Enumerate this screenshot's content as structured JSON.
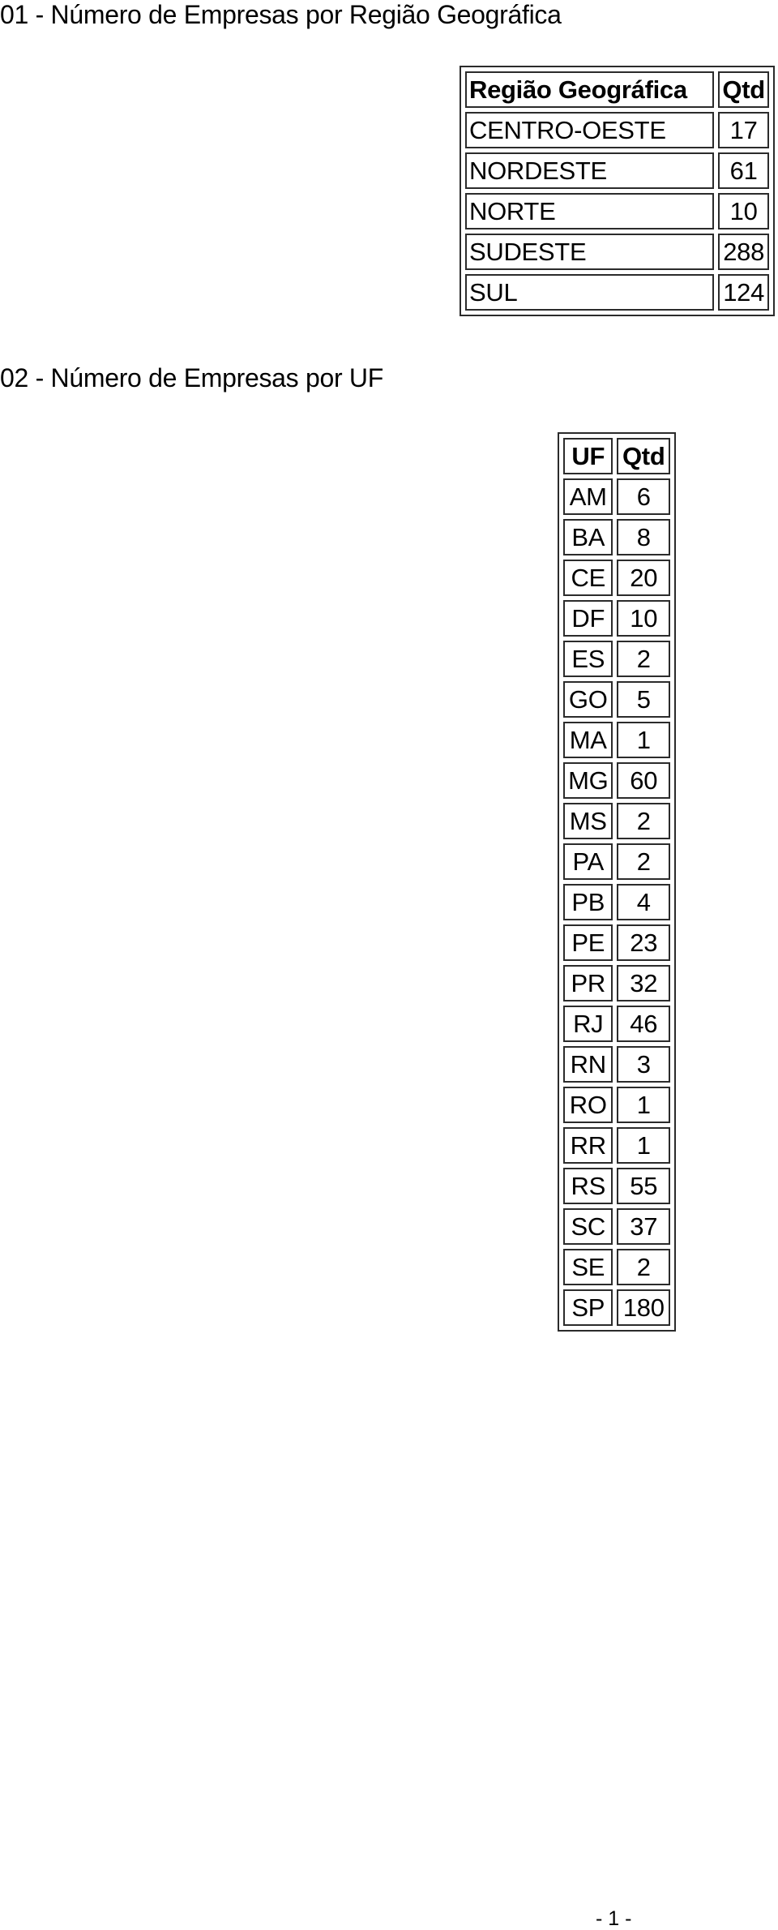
{
  "sections": [
    {
      "title": "01 - Número de Empresas por Região Geográfica",
      "table": {
        "headers": [
          "Região Geográfica",
          "Qtd"
        ],
        "rows": [
          [
            "CENTRO-OESTE",
            "17"
          ],
          [
            "NORDESTE",
            "61"
          ],
          [
            "NORTE",
            "10"
          ],
          [
            "SUDESTE",
            "288"
          ],
          [
            "SUL",
            "124"
          ]
        ]
      }
    },
    {
      "title": "02 - Número de Empresas por UF",
      "table": {
        "headers": [
          "UF",
          "Qtd"
        ],
        "rows": [
          [
            "AM",
            "6"
          ],
          [
            "BA",
            "8"
          ],
          [
            "CE",
            "20"
          ],
          [
            "DF",
            "10"
          ],
          [
            "ES",
            "2"
          ],
          [
            "GO",
            "5"
          ],
          [
            "MA",
            "1"
          ],
          [
            "MG",
            "60"
          ],
          [
            "MS",
            "2"
          ],
          [
            "PA",
            "2"
          ],
          [
            "PB",
            "4"
          ],
          [
            "PE",
            "23"
          ],
          [
            "PR",
            "32"
          ],
          [
            "RJ",
            "46"
          ],
          [
            "RN",
            "3"
          ],
          [
            "RO",
            "1"
          ],
          [
            "RR",
            "1"
          ],
          [
            "RS",
            "55"
          ],
          [
            "SC",
            "37"
          ],
          [
            "SE",
            "2"
          ],
          [
            "SP",
            "180"
          ]
        ]
      }
    }
  ],
  "footer": {
    "page_number": "- 1 -"
  }
}
